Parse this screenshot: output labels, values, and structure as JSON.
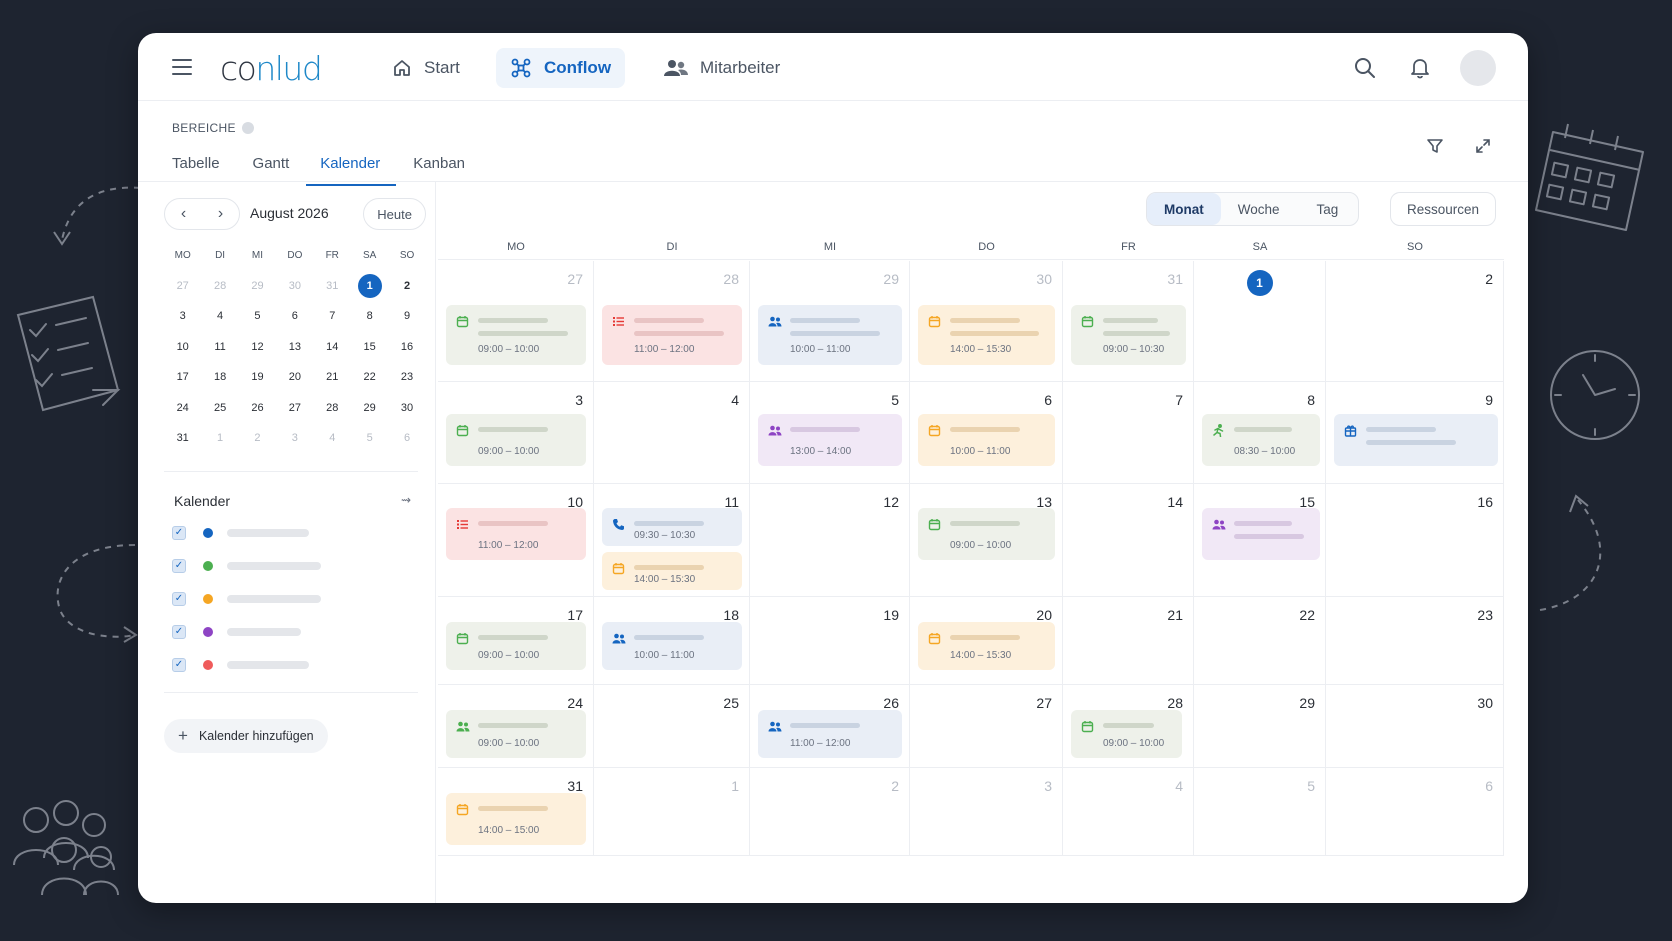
{
  "header": {
    "logo": {
      "part1": "co",
      "part2": "nlud"
    },
    "nav": [
      {
        "label": "Start",
        "icon": "home-icon"
      },
      {
        "label": "Conflow",
        "icon": "workflow-icon",
        "active": true
      },
      {
        "label": "Mitarbeiter",
        "icon": "people-icon"
      }
    ]
  },
  "section": {
    "label": "BEREICHE",
    "tabs": [
      "Tabelle",
      "Gantt",
      "Kalender",
      "Kanban"
    ],
    "active_tab": "Kalender"
  },
  "mini_calendar": {
    "month_label": "August 2026",
    "today_label": "Heute",
    "weekdays": [
      "MO",
      "DI",
      "MI",
      "DO",
      "FR",
      "SA",
      "SO"
    ],
    "weeks": [
      [
        "27",
        "28",
        "29",
        "30",
        "31",
        "1",
        "2"
      ],
      [
        "3",
        "4",
        "5",
        "6",
        "7",
        "8",
        "9"
      ],
      [
        "10",
        "11",
        "12",
        "13",
        "14",
        "15",
        "16"
      ],
      [
        "17",
        "18",
        "19",
        "20",
        "21",
        "22",
        "23"
      ],
      [
        "24",
        "25",
        "26",
        "27",
        "28",
        "29",
        "30"
      ],
      [
        "31",
        "1",
        "2",
        "3",
        "4",
        "5",
        "6"
      ]
    ]
  },
  "calendars_panel": {
    "title": "Kalender",
    "arrow": "⇝",
    "items": [
      {
        "color": "#1565c0",
        "checked": true
      },
      {
        "color": "#4caf50",
        "checked": true
      },
      {
        "color": "#f5a623",
        "checked": true
      },
      {
        "color": "#8e44c4",
        "checked": true
      },
      {
        "color": "#ef5b5b",
        "checked": true
      }
    ],
    "add_label": "Kalender hinzufügen"
  },
  "view_switch": {
    "options": [
      "Monat",
      "Woche",
      "Tag"
    ],
    "active": "Monat",
    "resources_label": "Ressourcen"
  },
  "month_grid": {
    "weekdays": [
      "MO",
      "DI",
      "MI",
      "DO",
      "FR",
      "SA",
      "SO"
    ],
    "weeks": [
      [
        "27",
        "28",
        "29",
        "30",
        "31",
        "1",
        "2"
      ],
      [
        "3",
        "4",
        "5",
        "6",
        "7",
        "8",
        "9"
      ],
      [
        "10",
        "11",
        "12",
        "13",
        "14",
        "15",
        "16"
      ],
      [
        "17",
        "18",
        "19",
        "20",
        "21",
        "22",
        "23"
      ],
      [
        "24",
        "25",
        "26",
        "27",
        "28",
        "29",
        "30"
      ],
      [
        "31",
        "1",
        "2",
        "3",
        "4",
        "5",
        "6"
      ]
    ],
    "events": [
      {
        "week": 0,
        "day": 0,
        "slot": 0,
        "color": "green",
        "icon": "calendar-icon",
        "time": "09:00 – 10:00"
      },
      {
        "week": 0,
        "day": 1,
        "slot": 0,
        "color": "red",
        "icon": "list-icon",
        "time": "11:00 – 12:00"
      },
      {
        "week": 0,
        "day": 2,
        "slot": 0,
        "color": "blue",
        "icon": "people-icon",
        "time": "10:00 – 11:00"
      },
      {
        "week": 0,
        "day": 3,
        "slot": 0,
        "color": "orange",
        "icon": "calendar-icon",
        "time": "14:00 – 15:30"
      },
      {
        "week": 0,
        "day": 4,
        "slot": 0,
        "color": "green",
        "icon": "calendar-icon",
        "time": "09:00 – 10:30"
      },
      {
        "week": 1,
        "day": 0,
        "slot": 0,
        "color": "green",
        "icon": "calendar-icon",
        "time": "09:00 – 10:00"
      },
      {
        "week": 1,
        "day": 2,
        "slot": 0,
        "color": "purple",
        "icon": "people-icon",
        "time": "13:00 – 14:00"
      },
      {
        "week": 1,
        "day": 3,
        "slot": 0,
        "color": "orange",
        "icon": "calendar-icon",
        "time": "10:00 – 11:00"
      },
      {
        "week": 1,
        "day": 5,
        "slot": 0,
        "color": "green",
        "icon": "running-icon",
        "time": "08:30 – 10:00"
      },
      {
        "week": 1,
        "day": 6,
        "slot": 0,
        "color": "blue",
        "icon": "gift-icon",
        "time": ""
      },
      {
        "week": 2,
        "day": 0,
        "slot": 0,
        "color": "red",
        "icon": "list-icon",
        "time": "11:00 – 12:00"
      },
      {
        "week": 2,
        "day": 1,
        "slot": 0,
        "color": "blue",
        "icon": "phone-icon",
        "time": "09:30 – 10:30"
      },
      {
        "week": 2,
        "day": 1,
        "slot": 1,
        "color": "orange",
        "icon": "calendar-icon",
        "time": "14:00 – 15:30"
      },
      {
        "week": 2,
        "day": 3,
        "slot": 0,
        "color": "green",
        "icon": "calendar-icon",
        "time": "09:00 – 10:00"
      },
      {
        "week": 2,
        "day": 5,
        "slot": 0,
        "color": "purple",
        "icon": "people-icon",
        "time": ""
      },
      {
        "week": 3,
        "day": 0,
        "slot": 0,
        "color": "green",
        "icon": "calendar-icon",
        "time": "09:00 – 10:00"
      },
      {
        "week": 3,
        "day": 1,
        "slot": 0,
        "color": "blue",
        "icon": "people-icon",
        "time": "10:00 – 11:00"
      },
      {
        "week": 3,
        "day": 3,
        "slot": 0,
        "color": "orange",
        "icon": "calendar-icon",
        "time": "14:00 – 15:30"
      },
      {
        "week": 4,
        "day": 0,
        "slot": 0,
        "color": "green",
        "icon": "people-icon",
        "time": "09:00 – 10:00"
      },
      {
        "week": 4,
        "day": 2,
        "slot": 0,
        "color": "blue",
        "icon": "people-icon",
        "time": "11:00 – 12:00"
      },
      {
        "week": 4,
        "day": 4,
        "slot": 0,
        "color": "green",
        "icon": "calendar-icon",
        "time": "09:00 – 10:00"
      },
      {
        "week": 5,
        "day": 0,
        "slot": 0,
        "color": "orange",
        "icon": "calendar-icon",
        "time": "14:00 – 15:00"
      }
    ]
  },
  "colors": {
    "accent": "#1565c0",
    "green": "#4caf50",
    "red": "#e53935",
    "blue": "#1565c0",
    "orange": "#f5a623",
    "purple": "#8e44c4"
  }
}
